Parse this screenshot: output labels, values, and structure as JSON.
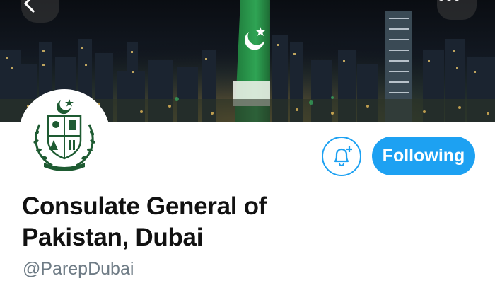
{
  "profile": {
    "display_name": "Consulate General of Pakistan, Dubai",
    "handle": "@ParepDubai",
    "follow_state_label": "Following"
  },
  "banner": {
    "description_icon": "city-skyline-with-flag-projection"
  },
  "icons": {
    "back": "chevron-left-icon",
    "more": "more-dots-icon",
    "notify": "bell-plus-icon",
    "avatar": "state-emblem-logo"
  },
  "colors": {
    "accent": "#1da1f2",
    "text_primary": "#111111",
    "text_secondary": "#6e7b85"
  }
}
